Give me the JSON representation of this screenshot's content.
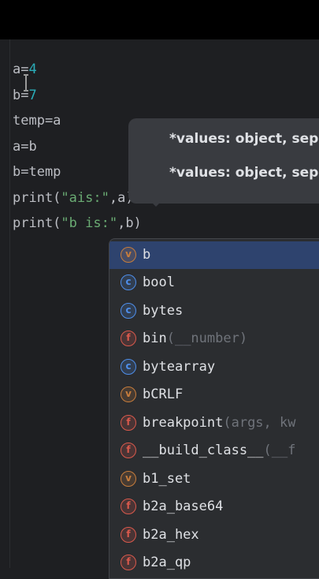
{
  "code": {
    "lines": [
      {
        "parts": [
          "a=",
          "4"
        ]
      },
      {
        "parts": [
          "b=",
          "7"
        ]
      },
      {
        "text": "temp=a"
      },
      {
        "text": "a=b"
      },
      {
        "text": "b=temp"
      },
      {
        "parts": [
          "print(",
          "\"ais:\"",
          ",a)"
        ]
      },
      {
        "parts": [
          "print(",
          "\"b is:\"",
          ",b)"
        ]
      }
    ]
  },
  "parameter_info": {
    "hints": [
      "*values: object, sep",
      "*values: object, sep"
    ]
  },
  "completion": {
    "items": [
      {
        "icon": "variable-icon",
        "glyph": "v",
        "name": "b",
        "args": "",
        "selected": true
      },
      {
        "icon": "class-icon",
        "glyph": "c",
        "name": "bool",
        "args": ""
      },
      {
        "icon": "class-icon",
        "glyph": "c",
        "name": "bytes",
        "args": ""
      },
      {
        "icon": "function-icon",
        "glyph": "f",
        "name": "bin",
        "args": "(__number)"
      },
      {
        "icon": "class-icon",
        "glyph": "c",
        "name": "bytearray",
        "args": ""
      },
      {
        "icon": "variable-icon",
        "glyph": "v",
        "name": "bCRLF",
        "args": ""
      },
      {
        "icon": "function-icon",
        "glyph": "f",
        "name": "breakpoint",
        "args": "(args, kw"
      },
      {
        "icon": "function-icon",
        "glyph": "f",
        "name": "__build_class__",
        "args": "(__f"
      },
      {
        "icon": "variable-icon",
        "glyph": "v",
        "name": "b1_set",
        "args": ""
      },
      {
        "icon": "function-icon",
        "glyph": "f",
        "name": "b2a_base64",
        "args": ""
      },
      {
        "icon": "function-icon",
        "glyph": "f",
        "name": "b2a_hex",
        "args": ""
      },
      {
        "icon": "function-icon",
        "glyph": "f",
        "name": "b2a_qp",
        "args": ""
      }
    ]
  },
  "colors": {
    "editor_bg": "#1e1f22",
    "number": "#2aacb8",
    "string": "#6aab73",
    "selection": "#2e436e",
    "popup_bg": "#2b2d30",
    "hint_bg": "#393b40"
  }
}
